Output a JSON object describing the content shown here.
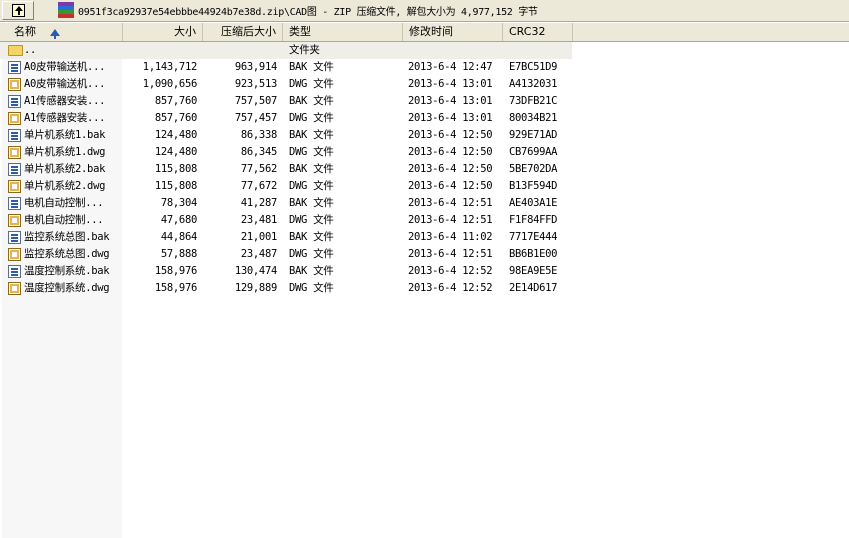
{
  "address": {
    "text": "0951f3ca92937e54ebbbe44924b7e38d.zip\\CAD图 - ZIP 压缩文件, 解包大小为 4,977,152 字节"
  },
  "columns": {
    "name": "名称",
    "size": "大小",
    "csize": "压缩后大小",
    "type": "类型",
    "modified": "修改时间",
    "crc": "CRC32"
  },
  "parent_row": {
    "name": "..",
    "type": "文件夹"
  },
  "files": [
    {
      "icon": "bak-file-icon",
      "name": "A0皮带输送机...",
      "size": "1,143,712",
      "csize": "963,914",
      "type": "BAK 文件",
      "modified": "2013-6-4  12:47",
      "crc": "E7BC51D9"
    },
    {
      "icon": "dwg-file-icon",
      "name": "A0皮带输送机...",
      "size": "1,090,656",
      "csize": "923,513",
      "type": "DWG 文件",
      "modified": "2013-6-4  13:01",
      "crc": "A4132031"
    },
    {
      "icon": "bak-file-icon",
      "name": "A1传感器安装...",
      "size": "857,760",
      "csize": "757,507",
      "type": "BAK 文件",
      "modified": "2013-6-4  13:01",
      "crc": "73DFB21C"
    },
    {
      "icon": "dwg-file-icon",
      "name": "A1传感器安装...",
      "size": "857,760",
      "csize": "757,457",
      "type": "DWG 文件",
      "modified": "2013-6-4  13:01",
      "crc": "80034B21"
    },
    {
      "icon": "bak-file-icon",
      "name": "单片机系统1.bak",
      "size": "124,480",
      "csize": "86,338",
      "type": "BAK 文件",
      "modified": "2013-6-4  12:50",
      "crc": "929E71AD"
    },
    {
      "icon": "dwg-file-icon",
      "name": "单片机系统1.dwg",
      "size": "124,480",
      "csize": "86,345",
      "type": "DWG 文件",
      "modified": "2013-6-4  12:50",
      "crc": "CB7699AA"
    },
    {
      "icon": "bak-file-icon",
      "name": "单片机系统2.bak",
      "size": "115,808",
      "csize": "77,562",
      "type": "BAK 文件",
      "modified": "2013-6-4  12:50",
      "crc": "5BE702DA"
    },
    {
      "icon": "dwg-file-icon",
      "name": "单片机系统2.dwg",
      "size": "115,808",
      "csize": "77,672",
      "type": "DWG 文件",
      "modified": "2013-6-4  12:50",
      "crc": "B13F594D"
    },
    {
      "icon": "bak-file-icon",
      "name": "电机自动控制...",
      "size": "78,304",
      "csize": "41,287",
      "type": "BAK 文件",
      "modified": "2013-6-4  12:51",
      "crc": "AE403A1E"
    },
    {
      "icon": "dwg-file-icon",
      "name": "电机自动控制...",
      "size": "47,680",
      "csize": "23,481",
      "type": "DWG 文件",
      "modified": "2013-6-4  12:51",
      "crc": "F1F84FFD"
    },
    {
      "icon": "bak-file-icon",
      "name": "监控系统总图.bak",
      "size": "44,864",
      "csize": "21,001",
      "type": "BAK 文件",
      "modified": "2013-6-4  11:02",
      "crc": "7717E444"
    },
    {
      "icon": "dwg-file-icon",
      "name": "监控系统总图.dwg",
      "size": "57,888",
      "csize": "23,487",
      "type": "DWG 文件",
      "modified": "2013-6-4  12:51",
      "crc": "BB6B1E00"
    },
    {
      "icon": "bak-file-icon",
      "name": "温度控制系统.bak",
      "size": "158,976",
      "csize": "130,474",
      "type": "BAK 文件",
      "modified": "2013-6-4  12:52",
      "crc": "98EA9E5E"
    },
    {
      "icon": "dwg-file-icon",
      "name": "温度控制系统.dwg",
      "size": "158,976",
      "csize": "129,889",
      "type": "DWG 文件",
      "modified": "2013-6-4  12:52",
      "crc": "2E14D617"
    }
  ]
}
